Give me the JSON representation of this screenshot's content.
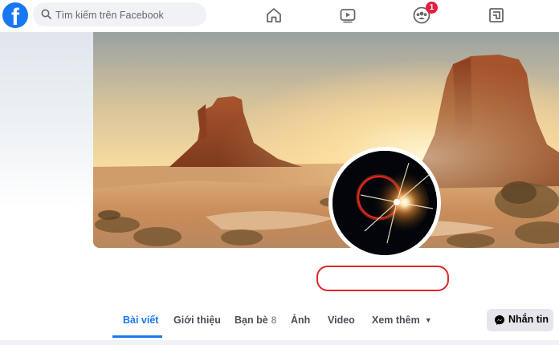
{
  "topbar": {
    "logo_letter": "f",
    "search_placeholder": "Tìm kiếm trên Facebook",
    "nav_icons": [
      "home-icon",
      "watch-icon",
      "groups-icon",
      "gaming-icon"
    ],
    "groups_badge": "1"
  },
  "colors": {
    "brand": "#1877f2",
    "badge": "#e41e3f",
    "highlight_outline": "#e0262b"
  },
  "profile": {
    "cover_description": "desert mesa landscape at sunset",
    "avatar_description": "solar eclipse ring with light flare"
  },
  "tabs": [
    {
      "label": "Bài viết",
      "active": true
    },
    {
      "label": "Giới thiệu"
    },
    {
      "label": "Bạn bè",
      "count": "8"
    },
    {
      "label": "Ảnh"
    },
    {
      "label": "Video"
    },
    {
      "label": "Xem thêm"
    }
  ],
  "actions": {
    "message_label": "Nhắn tin"
  }
}
